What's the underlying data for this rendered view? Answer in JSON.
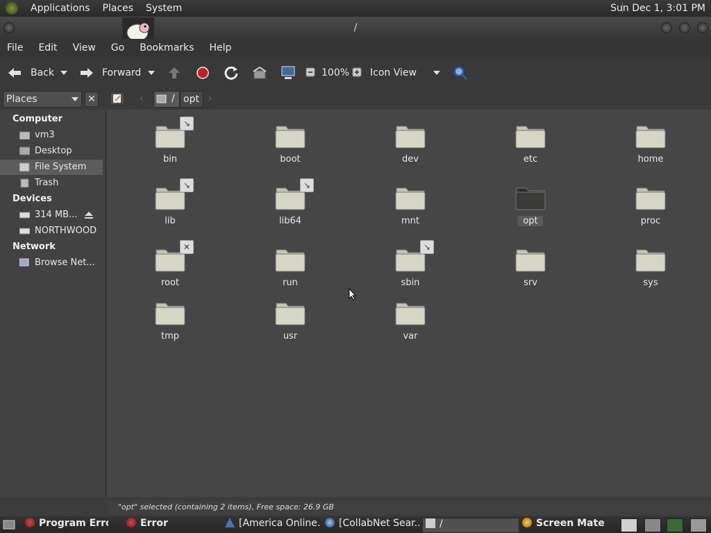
{
  "top_panel": {
    "menus": [
      "Applications",
      "Places",
      "System"
    ],
    "clock": "Sun Dec 1,  3:01 PM"
  },
  "window": {
    "title": "/"
  },
  "menubar": [
    "File",
    "Edit",
    "View",
    "Go",
    "Bookmarks",
    "Help"
  ],
  "toolbar": {
    "back_label": "Back",
    "forward_label": "Forward",
    "zoom": "100%",
    "view_mode": "Icon View"
  },
  "location": {
    "path_root": "/",
    "path_child": "opt"
  },
  "sidebar": {
    "combo_label": "Places",
    "computer_heading": "Computer",
    "computer_items": [
      "vm3",
      "Desktop",
      "File System",
      "Trash"
    ],
    "devices_heading": "Devices",
    "devices_items": [
      "314 MB...",
      "NORTHWOOD"
    ],
    "network_heading": "Network",
    "network_items": [
      "Browse Net..."
    ]
  },
  "files": [
    {
      "name": "bin",
      "emblem": "link"
    },
    {
      "name": "boot",
      "emblem": ""
    },
    {
      "name": "dev",
      "emblem": ""
    },
    {
      "name": "etc",
      "emblem": ""
    },
    {
      "name": "home",
      "emblem": ""
    },
    {
      "name": "lib",
      "emblem": "link"
    },
    {
      "name": "lib64",
      "emblem": "link"
    },
    {
      "name": "mnt",
      "emblem": ""
    },
    {
      "name": "opt",
      "emblem": "",
      "selected": true
    },
    {
      "name": "proc",
      "emblem": ""
    },
    {
      "name": "root",
      "emblem": "locked"
    },
    {
      "name": "run",
      "emblem": ""
    },
    {
      "name": "sbin",
      "emblem": "link"
    },
    {
      "name": "srv",
      "emblem": ""
    },
    {
      "name": "sys",
      "emblem": ""
    },
    {
      "name": "tmp",
      "emblem": ""
    },
    {
      "name": "usr",
      "emblem": ""
    },
    {
      "name": "var",
      "emblem": ""
    }
  ],
  "status": "\"opt\" selected (containing 2 items), Free space: 26.9 GB",
  "taskbar": [
    {
      "label": "Program Error",
      "bold": true
    },
    {
      "label": "Error",
      "bold": true
    },
    {
      "label": "[America Online..."
    },
    {
      "label": "[CollabNet Sear..."
    },
    {
      "label": "/",
      "active": true
    },
    {
      "label": "Screen Mate",
      "bold": true
    }
  ],
  "colors": {
    "panel": "#2a2a2a",
    "background": "#464646",
    "folder": "#d6d6c4",
    "folder_selected": "#3a3a38"
  }
}
